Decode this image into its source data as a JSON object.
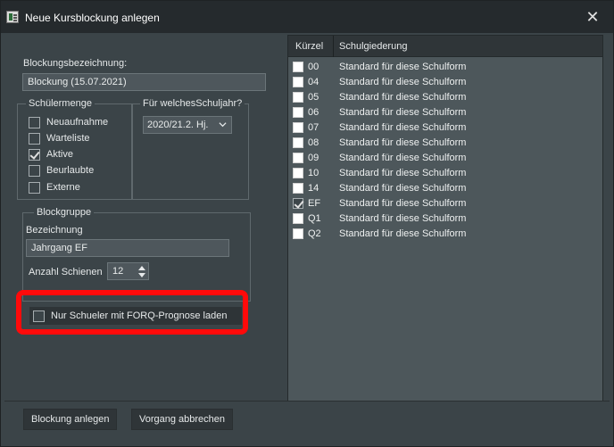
{
  "window": {
    "title": "Neue Kursblockung anlegen",
    "close_icon": "close-icon",
    "app_icon": "app-table-icon"
  },
  "form": {
    "blockungsbezeichnung_label": "Blockungsbezeichnung:",
    "blockungsbezeichnung_value": "Blockung (15.07.2021)",
    "schuelermenge": {
      "title": "Schülermenge",
      "options": [
        {
          "label": "Neuaufnahme",
          "checked": false
        },
        {
          "label": "Warteliste",
          "checked": false
        },
        {
          "label": "Aktive",
          "checked": true
        },
        {
          "label": "Beurlaubte",
          "checked": false
        },
        {
          "label": "Externe",
          "checked": false
        }
      ]
    },
    "schuljahr": {
      "title": "Für welchesSchuljahr?",
      "selected": "2020/21.2. Hj."
    },
    "blockgruppe": {
      "title": "Blockgruppe",
      "bezeichnung_label": "Bezeichnung",
      "bezeichnung_value": "Jahrgang EF",
      "anzahl_label": "Anzahl Schienen",
      "anzahl_value": "12"
    },
    "forq": {
      "label": "Nur Schueler mit FORQ-Prognose laden",
      "checked": false
    }
  },
  "list": {
    "columns": [
      "Kürzel",
      "Schulgiederung"
    ],
    "rows": [
      {
        "code": "00",
        "desc": "Standard für diese Schulform",
        "checked": false
      },
      {
        "code": "04",
        "desc": "Standard für diese Schulform",
        "checked": false
      },
      {
        "code": "05",
        "desc": "Standard für diese Schulform",
        "checked": false
      },
      {
        "code": "06",
        "desc": "Standard für diese Schulform",
        "checked": false
      },
      {
        "code": "07",
        "desc": "Standard für diese Schulform",
        "checked": false
      },
      {
        "code": "08",
        "desc": "Standard für diese Schulform",
        "checked": false
      },
      {
        "code": "09",
        "desc": "Standard für diese Schulform",
        "checked": false
      },
      {
        "code": "10",
        "desc": "Standard für diese Schulform",
        "checked": false
      },
      {
        "code": "14",
        "desc": "Standard für diese Schulform",
        "checked": false
      },
      {
        "code": "EF",
        "desc": "Standard für diese Schulform",
        "checked": true
      },
      {
        "code": "Q1",
        "desc": "Standard für diese Schulform",
        "checked": false
      },
      {
        "code": "Q2",
        "desc": "Standard für diese Schulform",
        "checked": false
      }
    ]
  },
  "buttons": {
    "create": "Blockung anlegen",
    "cancel": "Vorgang abbrechen"
  },
  "colors": {
    "highlight": "#ff0a0a",
    "background": "#3b4448",
    "list_background": "#4d575b"
  }
}
